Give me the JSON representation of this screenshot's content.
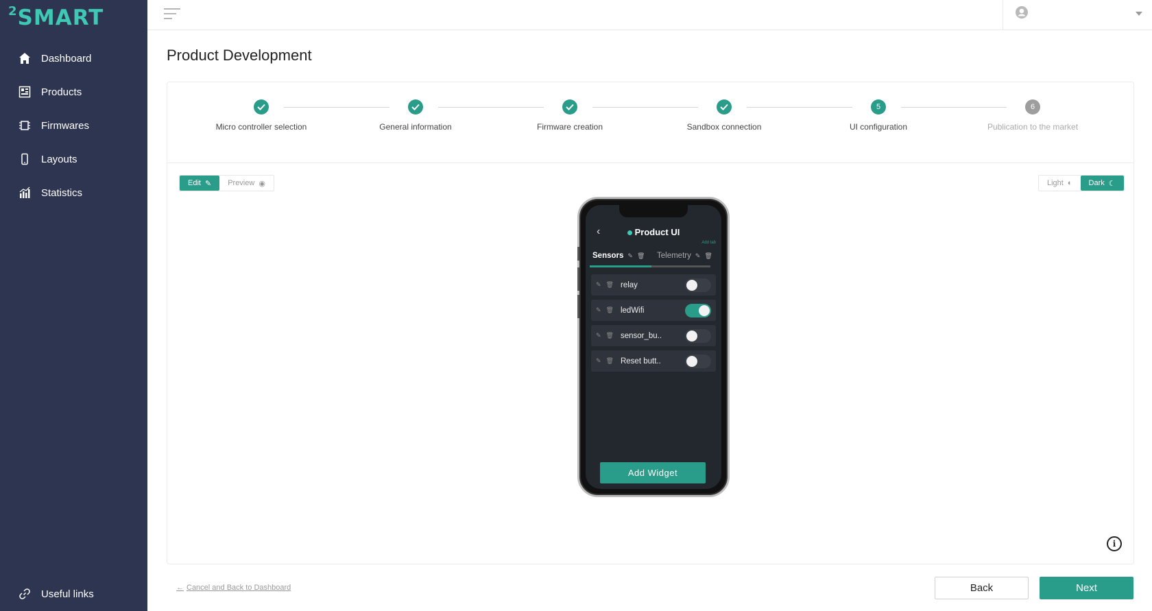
{
  "app": {
    "logo_text": "SMART",
    "logo_sup": "2",
    "brand_color": "#3fc8b4",
    "accent_color": "#2a9d8a"
  },
  "sidebar": {
    "items": [
      {
        "label": "Dashboard",
        "icon": "home-icon"
      },
      {
        "label": "Products",
        "icon": "products-icon"
      },
      {
        "label": "Firmwares",
        "icon": "chip-icon"
      },
      {
        "label": "Layouts",
        "icon": "phone-icon"
      },
      {
        "label": "Statistics",
        "icon": "chart-icon"
      }
    ],
    "footer_label": "Useful links"
  },
  "page": {
    "title": "Product Development"
  },
  "stepper": {
    "steps": [
      {
        "label": "Micro controller selection",
        "status": "done"
      },
      {
        "label": "General information",
        "status": "done"
      },
      {
        "label": "Firmware creation",
        "status": "done"
      },
      {
        "label": "Sandbox connection",
        "status": "done"
      },
      {
        "label": "UI configuration",
        "status": "current",
        "number": "5"
      },
      {
        "label": "Publication to the market",
        "status": "pending",
        "number": "6"
      }
    ]
  },
  "mode": {
    "edit": "Edit",
    "preview": "Preview",
    "selected": "Edit"
  },
  "theme": {
    "light": "Light",
    "dark": "Dark",
    "selected": "Dark"
  },
  "phone": {
    "title": "Product UI",
    "add_tab": "Add tab",
    "tabs": [
      {
        "label": "Sensors",
        "active": true
      },
      {
        "label": "Telemetry",
        "active": false
      }
    ],
    "widgets": [
      {
        "name": "relay",
        "on": false
      },
      {
        "name": "ledWifi",
        "on": true
      },
      {
        "name": "sensor_bu..",
        "on": false
      },
      {
        "name": "Reset butt..",
        "on": false
      }
    ],
    "add_widget": "Add Widget"
  },
  "footer": {
    "cancel": "Cancel and Back to Dashboard",
    "back": "Back",
    "next": "Next"
  }
}
